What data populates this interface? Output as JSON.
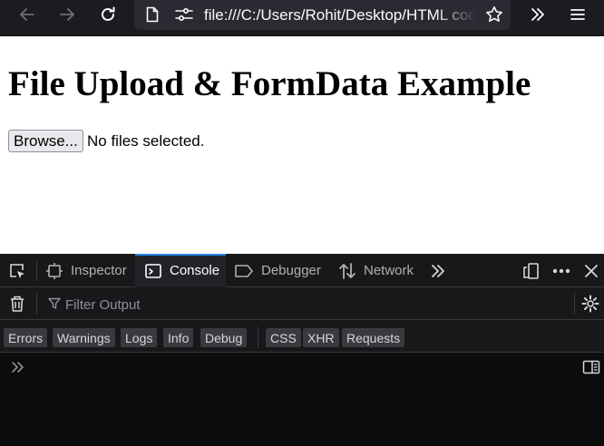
{
  "browser": {
    "url": "file:///C:/Users/Rohit/Desktop/HTML code/index.html"
  },
  "page": {
    "title": "File Upload & FormData Example",
    "browse_label": "Browse...",
    "file_status": "No files selected."
  },
  "devtools": {
    "tabs": [
      {
        "label": "Inspector"
      },
      {
        "label": "Console"
      },
      {
        "label": "Debugger"
      },
      {
        "label": "Network"
      }
    ],
    "active_tab": "Console",
    "filter_placeholder": "Filter Output",
    "level_filters": [
      "Errors",
      "Warnings",
      "Logs",
      "Info",
      "Debug"
    ],
    "type_filters": [
      "CSS",
      "XHR",
      "Requests"
    ],
    "accent_color": "#1e88e5"
  }
}
